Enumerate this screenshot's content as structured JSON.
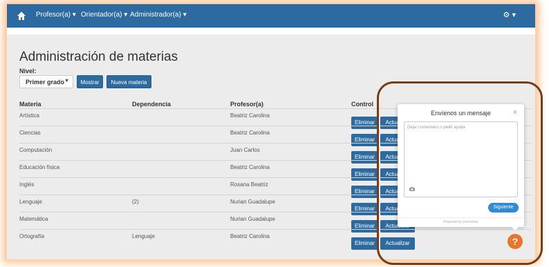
{
  "nav": {
    "items": [
      "Profesor(a) ▾",
      "Orientador(a) ▾",
      "Administrador(a) ▾"
    ],
    "gear": "⚙ ▾"
  },
  "page": {
    "title": "Administración de materias",
    "nivel_label": "Nivel:",
    "nivel_value": "Primer grado",
    "mostrar": "Mostrar",
    "nueva": "Nueva materia"
  },
  "table": {
    "headers": [
      "Materia",
      "Dependencia",
      "Profesor(a)",
      "Control"
    ],
    "eliminar": "Eliminar",
    "actualizar": "Actualizar",
    "rows": [
      {
        "materia": "Artística",
        "dependencia": "",
        "profesor": "Beatriz Carolina"
      },
      {
        "materia": "Ciencias",
        "dependencia": "",
        "profesor": "Beatriz Carolina"
      },
      {
        "materia": "Computación",
        "dependencia": "",
        "profesor": "Juan Carlos"
      },
      {
        "materia": "Educación física",
        "dependencia": "",
        "profesor": "Beatriz Carolina"
      },
      {
        "materia": "Inglés",
        "dependencia": "",
        "profesor": "Roxana Beatriz"
      },
      {
        "materia": "Lenguaje",
        "dependencia": "(2)",
        "profesor": "Nurian Guadalupe"
      },
      {
        "materia": "Matemática",
        "dependencia": "",
        "profesor": "Nurian Guadalupe"
      },
      {
        "materia": "Ortografía",
        "dependencia": "Lenguaje",
        "profesor": "Beatriz Carolina"
      }
    ]
  },
  "widget": {
    "title": "Envíenos un mensaje",
    "close": "×",
    "placeholder": "Dejar comentario o pedir ayuda",
    "next": "Siguiente",
    "footer": "Powered by UserVoice"
  },
  "help": "?"
}
